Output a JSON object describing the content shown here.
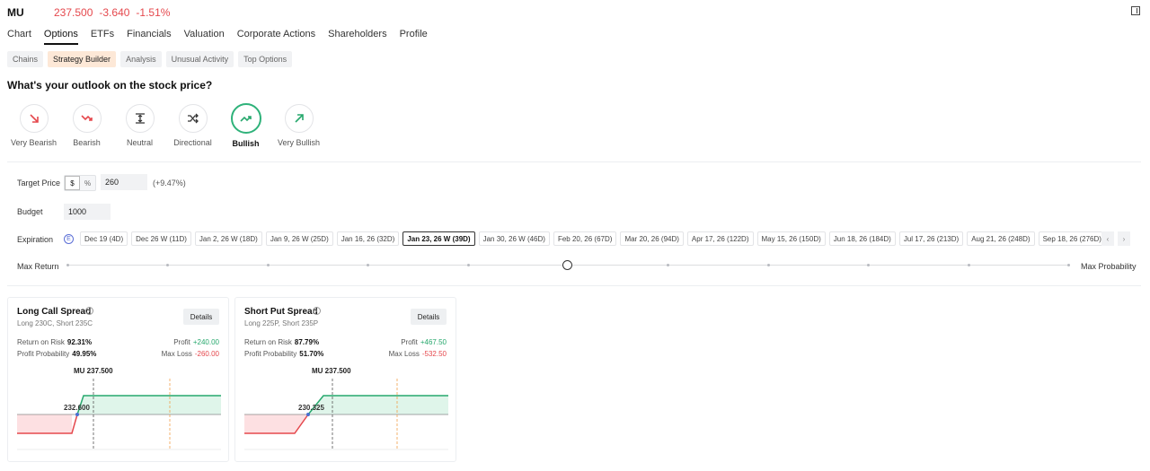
{
  "ticker": {
    "symbol": "MU",
    "price": "237.500",
    "change": "-3.640",
    "change_pct": "-1.51%"
  },
  "main_tabs": [
    "Chart",
    "Options",
    "ETFs",
    "Financials",
    "Valuation",
    "Corporate Actions",
    "Shareholders",
    "Profile"
  ],
  "sub_tabs": [
    "Chains",
    "Strategy Builder",
    "Analysis",
    "Unusual Activity",
    "Top Options"
  ],
  "outlook": {
    "title": "What's your outlook on the stock price?",
    "options": [
      {
        "label": "Very Bearish",
        "icon": "arrow-down-right-icon",
        "color": "#e5484d"
      },
      {
        "label": "Bearish",
        "icon": "trend-down-icon",
        "color": "#e5484d"
      },
      {
        "label": "Neutral",
        "icon": "neutral-range-icon",
        "color": "#333333"
      },
      {
        "label": "Directional",
        "icon": "shuffle-icon",
        "color": "#333333"
      },
      {
        "label": "Bullish",
        "icon": "trend-up-icon",
        "color": "#27a86d"
      },
      {
        "label": "Very Bullish",
        "icon": "arrow-up-right-icon",
        "color": "#27a86d"
      }
    ],
    "selected": "Bullish"
  },
  "form": {
    "target_label": "Target Price",
    "unit_dollar": "$",
    "unit_pct": "%",
    "target_value": "260",
    "target_pct": "(+9.47%)",
    "budget_label": "Budget",
    "budget_value": "1000",
    "expiration_label": "Expiration",
    "e_badge": "E",
    "expirations": [
      "Dec 19 (4D)",
      "Dec 26 W (11D)",
      "Jan 2, 26 W (18D)",
      "Jan 9, 26 W (25D)",
      "Jan 16, 26 (32D)",
      "Jan 23, 26 W (39D)",
      "Jan 30, 26 W (46D)",
      "Feb 20, 26 (67D)",
      "Mar 20, 26 (94D)",
      "Apr 17, 26 (122D)",
      "May 15, 26 (150D)",
      "Jun 18, 26 (184D)",
      "Jul 17, 26 (213D)",
      "Aug 21, 26 (248D)",
      "Sep 18, 26 (276D)"
    ],
    "selected_expiration": "Jan 23, 26 W (39D)",
    "slider_left": "Max Return",
    "slider_right": "Max Probability",
    "slider_value": 0.5
  },
  "strategies": [
    {
      "title": "Long Call Spread",
      "legs": "Long 230C, Short 235C",
      "details": "Details",
      "ror_label": "Return on Risk",
      "ror": "92.31%",
      "prob_label": "Profit Probability",
      "prob": "49.95%",
      "profit_label": "Profit",
      "profit": "+240.00",
      "loss_label": "Max Loss",
      "loss": "-260.00",
      "price_label": "MU 237.500",
      "breakeven": "232.600"
    },
    {
      "title": "Short Put Spread",
      "legs": "Long 225P, Short 235P",
      "details": "Details",
      "ror_label": "Return on Risk",
      "ror": "87.79%",
      "prob_label": "Profit Probability",
      "prob": "51.70%",
      "profit_label": "Profit",
      "profit": "+467.50",
      "loss_label": "Max Loss",
      "loss": "-532.50",
      "price_label": "MU 237.500",
      "breakeven": "230.325"
    }
  ],
  "colors": {
    "accent": "#e5484d",
    "profit": "#27a86d",
    "loss_fill": "#fde0e2",
    "profit_fill": "#dff5ea",
    "target_line": "#f0a04b"
  }
}
